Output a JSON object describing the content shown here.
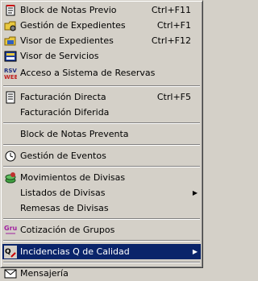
{
  "menu": {
    "items": [
      {
        "label": "Block de Notas Previo",
        "shortcut": "Ctrl+F11",
        "icon": "notepad-icon"
      },
      {
        "label": "Gestión de Expedientes",
        "shortcut": "Ctrl+F1",
        "icon": "folder-gear-icon"
      },
      {
        "label": "Visor de Expedientes",
        "shortcut": "Ctrl+F12",
        "icon": "folder-viewer-icon"
      },
      {
        "label": "Visor de Servicios",
        "shortcut": "",
        "icon": "services-viewer-icon"
      },
      {
        "label": "Acceso a Sistema de Reservas",
        "shortcut": "",
        "icon": "reservations-icon",
        "icon_text": "RSV WEB"
      },
      {
        "label": "Facturación Directa",
        "shortcut": "Ctrl+F5",
        "icon": "invoice-icon"
      },
      {
        "label": "Facturación Diferida",
        "shortcut": ""
      },
      {
        "label": "Block de Notas Preventa",
        "shortcut": ""
      },
      {
        "label": "Gestión de Eventos",
        "shortcut": "",
        "icon": "events-icon"
      },
      {
        "label": "Movimientos de Divisas",
        "shortcut": "",
        "icon": "currency-movement-icon"
      },
      {
        "label": "Listados de Divisas",
        "shortcut": "",
        "submenu": true
      },
      {
        "label": "Remesas de Divisas",
        "shortcut": ""
      },
      {
        "label": "Cotización de Grupos",
        "shortcut": "",
        "icon": "group-quote-icon",
        "icon_text": "Gru"
      },
      {
        "label": "Incidencias Q de Calidad",
        "shortcut": "",
        "icon": "quality-incident-icon",
        "submenu": true,
        "selected": true
      },
      {
        "label": "Mensajería",
        "shortcut": "",
        "icon": "messaging-icon"
      }
    ]
  },
  "colors": {
    "menu_bg": "#d4d0c8",
    "highlight": "#0a246a",
    "highlight_text": "#ffffff"
  }
}
